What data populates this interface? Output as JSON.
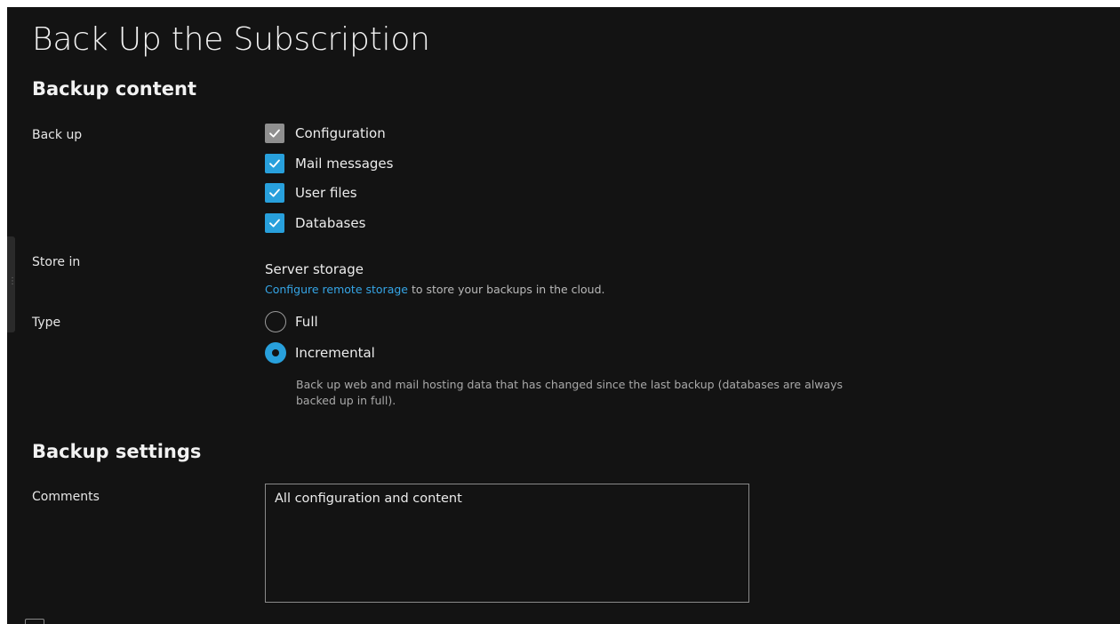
{
  "page": {
    "title": "Back Up the Subscription"
  },
  "backup_content": {
    "section_title": "Backup content",
    "back_up": {
      "label": "Back up",
      "options": [
        {
          "label": "Configuration",
          "checked": true,
          "disabled": true
        },
        {
          "label": "Mail messages",
          "checked": true,
          "disabled": false
        },
        {
          "label": "User files",
          "checked": true,
          "disabled": false
        },
        {
          "label": "Databases",
          "checked": true,
          "disabled": false
        }
      ]
    },
    "store_in": {
      "label": "Store in",
      "value": "Server storage",
      "link_text": "Configure remote storage",
      "hint_rest": " to store your backups in the cloud."
    },
    "type": {
      "label": "Type",
      "options": [
        {
          "label": "Full",
          "selected": false
        },
        {
          "label": "Incremental",
          "selected": true
        }
      ],
      "incremental_description": "Back up web and mail hosting data that has changed since the last backup (databases are always backed up in full)."
    }
  },
  "backup_settings": {
    "section_title": "Backup settings",
    "comments": {
      "label": "Comments",
      "value": "All configuration and content"
    }
  },
  "colors": {
    "background": "#131313",
    "accent": "#28a0dc",
    "link": "#35a5e6",
    "disabled_checkbox": "#8f8f8f"
  },
  "icons": {
    "check": "check-icon",
    "side_handle": "drag-handle-icon"
  }
}
